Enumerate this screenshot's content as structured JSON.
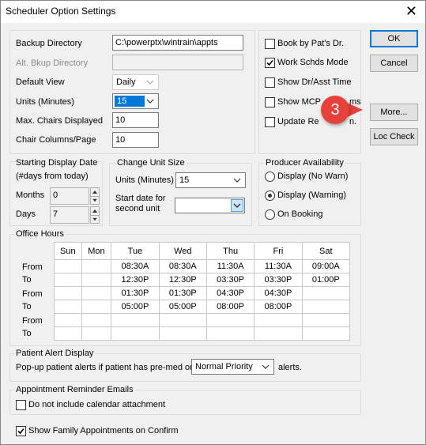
{
  "window": {
    "title": "Scheduler Option Settings",
    "close_glyph": "✕"
  },
  "dirs": {
    "backup_label": "Backup Directory",
    "backup_value": "C:\\powerptx\\wintrain\\appts",
    "alt_label": "Alt. Bkup Directory",
    "alt_value": "",
    "default_view_label": "Default View",
    "default_view_value": "Daily",
    "units_label": "Units (Minutes)",
    "units_value": "15",
    "max_chairs_label": "Max. Chairs Displayed",
    "max_chairs_value": "10",
    "chair_cols_label": "Chair Columns/Page",
    "chair_cols_value": "10"
  },
  "options": {
    "book_by": {
      "label": "Book by Pat's Dr.",
      "checked": false
    },
    "work_schds": {
      "label": "Work Schds Mode",
      "checked": true
    },
    "show_dr_asst": {
      "label": "Show Dr/Asst Time",
      "checked": false
    },
    "show_mcp": {
      "label": "Show MCP",
      "label_tail": "ms",
      "checked": false
    },
    "update_re": {
      "label": "Update Re",
      "label_tail": "n.",
      "checked": false
    }
  },
  "buttons": {
    "ok": "OK",
    "cancel": "Cancel",
    "more": "More...",
    "loc_check": "Loc Check"
  },
  "callout": {
    "number": "3",
    "color": "#e8413c"
  },
  "starting": {
    "title_line1": "Starting Display Date",
    "title_line2": "(#days from today)",
    "months_label": "Months",
    "months_value": "0",
    "days_label": "Days",
    "days_value": "7"
  },
  "unit_size": {
    "title": "Change Unit Size",
    "units_label": "Units (Minutes)",
    "units_value": "15",
    "start_label_line1": "Start date for",
    "start_label_line2": "second unit",
    "start_value": ""
  },
  "producer": {
    "title": "Producer Availability",
    "options": [
      {
        "label": "Display (No Warn)",
        "selected": false
      },
      {
        "label": "Display (Warning)",
        "selected": true
      },
      {
        "label": "On Booking",
        "selected": false
      }
    ]
  },
  "office_hours": {
    "title": "Office Hours",
    "days": [
      "Sun",
      "Mon",
      "Tue",
      "Wed",
      "Thu",
      "Fri",
      "Sat"
    ],
    "row_labels": [
      "From",
      "To",
      "From",
      "To",
      "From",
      "To"
    ],
    "rows": [
      [
        "",
        "",
        "08:30A",
        "08:30A",
        "11:30A",
        "11:30A",
        "09:00A"
      ],
      [
        "",
        "",
        "12:30P",
        "12:30P",
        "03:30P",
        "03:30P",
        "01:00P"
      ],
      [
        "",
        "",
        "01:30P",
        "01:30P",
        "04:30P",
        "04:30P",
        ""
      ],
      [
        "",
        "",
        "05:00P",
        "05:00P",
        "08:00P",
        "08:00P",
        ""
      ],
      [
        "",
        "",
        "",
        "",
        "",
        "",
        ""
      ],
      [
        "",
        "",
        "",
        "",
        "",
        "",
        ""
      ]
    ]
  },
  "alert": {
    "title": "Patient Alert Display",
    "prefix": "Pop-up patient alerts if patient has pre-med or",
    "value": "Normal Priority",
    "suffix": "alerts."
  },
  "reminder": {
    "title": "Appointment Reminder Emails",
    "no_attach_label": "Do not include calendar attachment",
    "no_attach_checked": false
  },
  "family": {
    "label": "Show Family Appointments on Confirm",
    "checked": true
  }
}
